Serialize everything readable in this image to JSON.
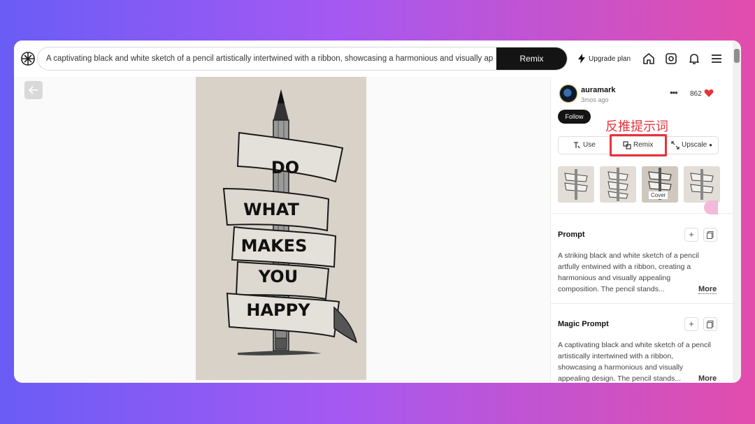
{
  "topbar": {
    "prompt": "A captivating black and white sketch of a pencil artistically intertwined with a ribbon, showcasing a harmonious and visually appealing design.",
    "remix_label": "Remix",
    "upgrade_label": "Upgrade plan",
    "icons": [
      "home-icon",
      "gallery-icon",
      "bell-icon",
      "menu-icon"
    ]
  },
  "artwork": {
    "words": [
      "DO",
      "WHAT",
      "MAKES",
      "YOU",
      "HAPPY"
    ]
  },
  "author": {
    "name": "auramark",
    "time": "3mos ago",
    "likes": "862",
    "follow_label": "Follow"
  },
  "annotation": "反推提示词",
  "actions": {
    "use": "Use",
    "remix": "Remix",
    "upscale": "Upscale"
  },
  "thumbnails": {
    "cover_label": "Cover"
  },
  "prompt_section": {
    "title": "Prompt",
    "text": "A striking black and white sketch of a pencil artfully entwined with a ribbon, creating a harmonious and visually appealing composition. The pencil stands...",
    "more": "More"
  },
  "magic_section": {
    "title": "Magic Prompt",
    "text": "A captivating black and white sketch of a pencil artistically intertwined with a ribbon, showcasing a harmonious and visually appealing design. The pencil stands...",
    "more": "More"
  },
  "colors": {
    "accent": "#141414",
    "annotation": "#e8323c",
    "heart": "#e8323c"
  }
}
